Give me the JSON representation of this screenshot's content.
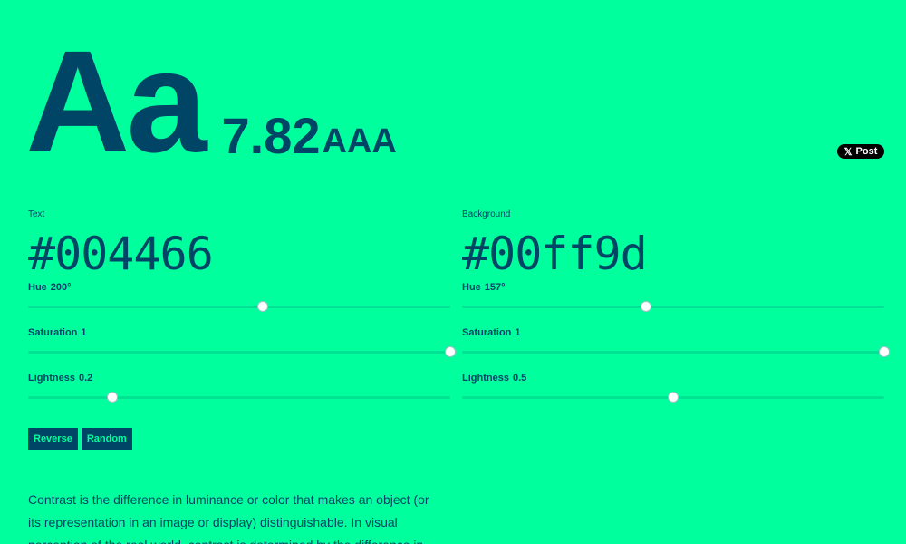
{
  "hero": {
    "sample": "Aa",
    "ratio": "7.82",
    "level": "AAA"
  },
  "share": {
    "x_icon": "x-logo-icon",
    "label": "Post"
  },
  "text_color": {
    "label": "Text",
    "hex": "#004466",
    "hue": {
      "label": "Hue",
      "value": "200°",
      "fraction": 0.555
    },
    "saturation": {
      "label": "Saturation",
      "value": "1",
      "fraction": 1.0
    },
    "lightness": {
      "label": "Lightness",
      "value": "0.2",
      "fraction": 0.2
    }
  },
  "bg_color": {
    "label": "Background",
    "hex": "#00ff9d",
    "hue": {
      "label": "Hue",
      "value": "157°",
      "fraction": 0.436
    },
    "saturation": {
      "label": "Saturation",
      "value": "1",
      "fraction": 1.0
    },
    "lightness": {
      "label": "Lightness",
      "value": "0.5",
      "fraction": 0.5
    }
  },
  "buttons": {
    "reverse": "Reverse",
    "random": "Random"
  },
  "description": "Contrast is the difference in luminance or color that makes an object (or its representation in an image or display) distinguishable. In visual perception of the real world, contrast is determined by the difference in",
  "colors": {
    "foreground": "#004466",
    "background": "#00ff9d"
  }
}
